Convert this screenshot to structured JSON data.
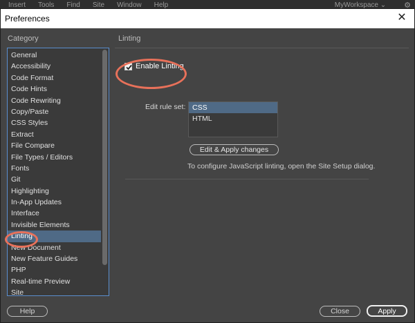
{
  "background_menu": {
    "items": [
      "Insert",
      "Tools",
      "Find",
      "Site",
      "Window",
      "Help"
    ],
    "workspace": "MyWorkspace",
    "workspace_chevron": "chevron-down-icon",
    "gear_icon": "gear-icon"
  },
  "dialog": {
    "title": "Preferences",
    "close_symbol": "✕"
  },
  "category": {
    "heading": "Category",
    "items": [
      "General",
      "Accessibility",
      "Code Format",
      "Code Hints",
      "Code Rewriting",
      "Copy/Paste",
      "CSS Styles",
      "Extract",
      "File Compare",
      "File Types / Editors",
      "Fonts",
      "Git",
      "Highlighting",
      "In-App Updates",
      "Interface",
      "Invisible Elements",
      "Linting",
      "New Document",
      "New Feature Guides",
      "PHP",
      "Real-time Preview",
      "Site"
    ],
    "selected": "Linting"
  },
  "linting": {
    "heading": "Linting",
    "enable_label": "Enable Linting",
    "enable_checked": true,
    "rule_set_label": "Edit rule set:",
    "rule_sets": [
      "CSS",
      "HTML"
    ],
    "rule_set_selected": "CSS",
    "edit_button": "Edit  & Apply changes",
    "info": "To configure JavaScript linting, open the Site Setup dialog."
  },
  "buttons": {
    "help": "Help",
    "close": "Close",
    "apply": "Apply"
  },
  "colors": {
    "highlight_ring": "#e8715a",
    "selection": "#4f6a86",
    "list_border": "#5b8fd0"
  }
}
